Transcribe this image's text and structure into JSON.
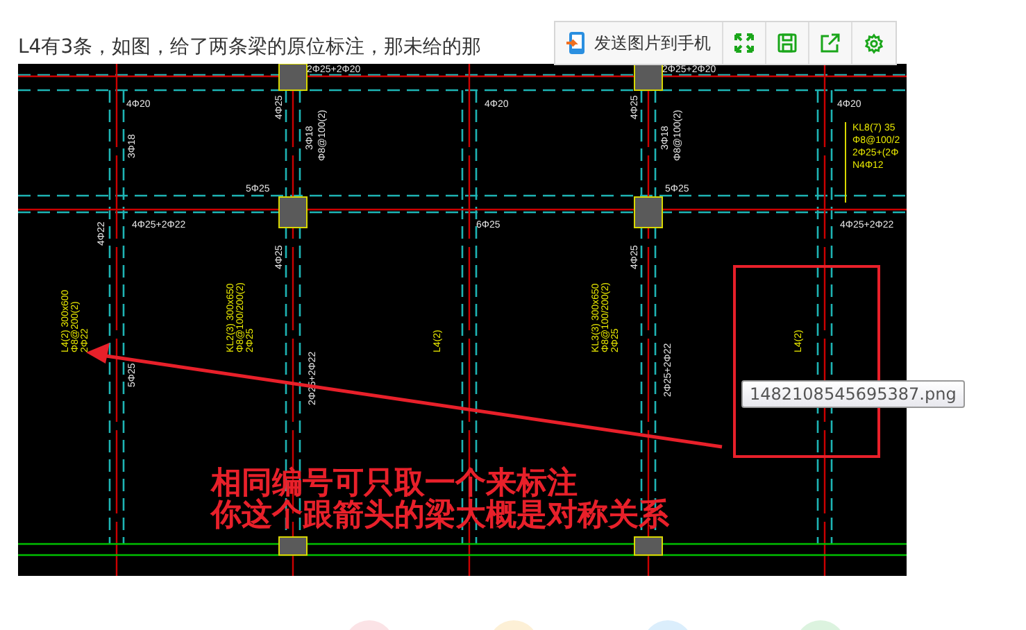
{
  "question": {
    "text": "L4有3条，如图，给了两条梁的原位标注，那未给的那"
  },
  "image_toolbar": {
    "send_button": "发送图片到手机"
  },
  "drawing": {
    "labels": [
      {
        "text": "2Φ25+2Φ20",
        "kind": "steel"
      },
      {
        "text": "2Φ25+2Φ20",
        "kind": "steel"
      },
      {
        "text": "4Φ20",
        "kind": "steel"
      },
      {
        "text": "4Φ20",
        "kind": "steel"
      },
      {
        "text": "4Φ20",
        "kind": "steel"
      },
      {
        "text": "3Φ18",
        "kind": "steel"
      },
      {
        "text": "4Φ25",
        "kind": "steel"
      },
      {
        "text": "4Φ25",
        "kind": "steel"
      },
      {
        "text": "3Φ18",
        "kind": "steel"
      },
      {
        "text": "Φ8@100(2)",
        "kind": "steel"
      },
      {
        "text": "3Φ18",
        "kind": "steel"
      },
      {
        "text": "Φ8@100(2)",
        "kind": "steel"
      },
      {
        "text": "KL8(7) 35",
        "kind": "beam"
      },
      {
        "text": "Φ8@100/2",
        "kind": "beam"
      },
      {
        "text": "2Φ25+(2Φ",
        "kind": "beam"
      },
      {
        "text": "N4Φ12",
        "kind": "beam"
      },
      {
        "text": "5Φ25",
        "kind": "steel"
      },
      {
        "text": "5Φ25",
        "kind": "steel"
      },
      {
        "text": "4Φ25+2Φ22",
        "kind": "steel"
      },
      {
        "text": "6Φ25",
        "kind": "steel"
      },
      {
        "text": "4Φ25+2Φ22",
        "kind": "steel"
      },
      {
        "text": "4Φ22",
        "kind": "steel"
      },
      {
        "text": "4Φ25",
        "kind": "steel"
      },
      {
        "text": "4Φ25",
        "kind": "steel"
      },
      {
        "text": "5Φ25",
        "kind": "steel"
      },
      {
        "text": "2Φ25+2Φ22",
        "kind": "steel"
      },
      {
        "text": "2Φ25+2Φ22",
        "kind": "steel"
      },
      {
        "text": "L4(2) 300x600",
        "kind": "beam"
      },
      {
        "text": "Φ8@200(2)",
        "kind": "beam"
      },
      {
        "text": "2Φ22",
        "kind": "beam"
      },
      {
        "text": "KL2(3) 300x650",
        "kind": "beam"
      },
      {
        "text": "Φ8@100/200(2)",
        "kind": "beam"
      },
      {
        "text": "2Φ25",
        "kind": "beam"
      },
      {
        "text": "L4(2)",
        "kind": "beam"
      },
      {
        "text": "KL3(3) 300x650",
        "kind": "beam"
      },
      {
        "text": "Φ8@100/200(2)",
        "kind": "beam"
      },
      {
        "text": "2Φ25",
        "kind": "beam"
      },
      {
        "text": "L4(2)",
        "kind": "beam"
      }
    ],
    "annotation_lines": [
      "相同编号可只取一个来标注",
      "你这个跟箭头的梁大概是对称关系"
    ]
  },
  "tooltip": {
    "text": "1482108545695387.png"
  }
}
